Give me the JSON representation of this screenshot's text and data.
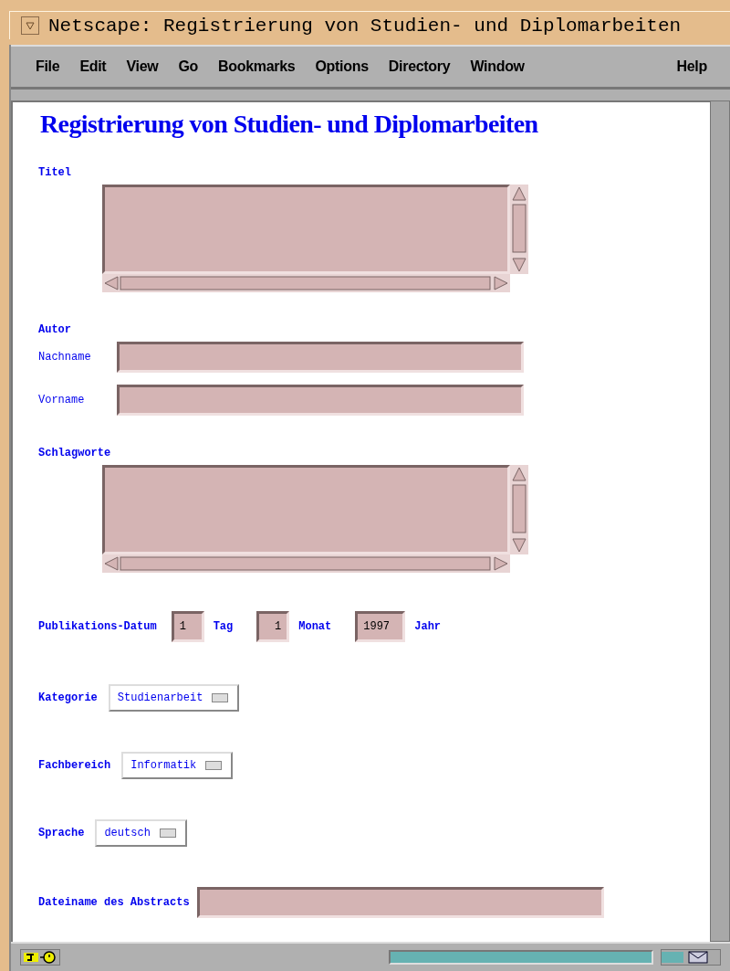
{
  "window": {
    "title": "Netscape: Registrierung von Studien- und Diplomarbeiten"
  },
  "menu": [
    {
      "label": "File"
    },
    {
      "label": "Edit"
    },
    {
      "label": "View"
    },
    {
      "label": "Go"
    },
    {
      "label": "Bookmarks"
    },
    {
      "label": "Options"
    },
    {
      "label": "Directory"
    },
    {
      "label": "Window"
    }
  ],
  "help_menu": {
    "label": "Help"
  },
  "page": {
    "heading": "Registrierung von Studien- und Diplomarbeiten",
    "titel": {
      "label": "Titel"
    },
    "autor": {
      "label": "Autor",
      "fields": [
        {
          "label": "Nachname"
        },
        {
          "label": "Vorname"
        }
      ]
    },
    "schlagworte": {
      "label": "Schlagworte"
    },
    "datum": {
      "label": "Publikations-Datum",
      "parts": [
        {
          "value": "1",
          "unit": "Tag"
        },
        {
          "value": "1",
          "unit": "Monat"
        },
        {
          "value": "1997",
          "unit": "Jahr"
        }
      ]
    },
    "selects": [
      {
        "label": "Kategorie",
        "value": "Studienarbeit"
      },
      {
        "label": "Fachbereich",
        "value": "Informatik"
      },
      {
        "label": "Sprache",
        "value": "deutsch"
      }
    ],
    "abstract": {
      "label": "Dateiname des Abstracts"
    }
  }
}
